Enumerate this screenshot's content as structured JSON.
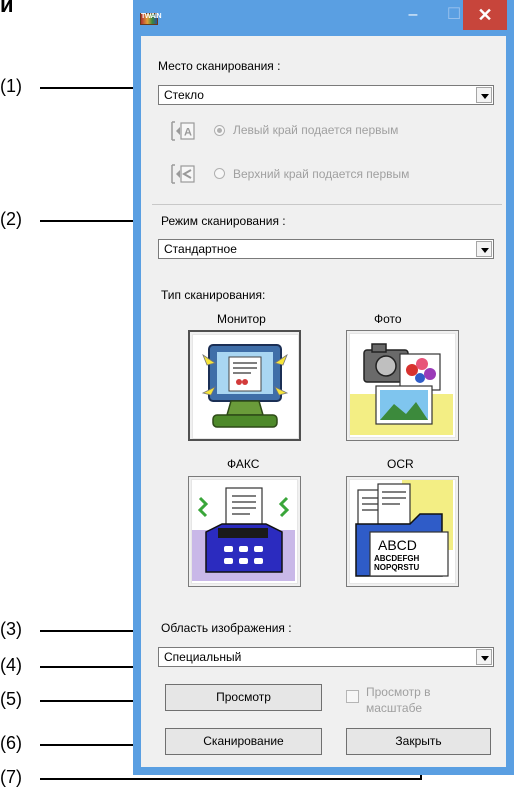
{
  "doc": {
    "corner_title": "и",
    "callouts": [
      "(1)",
      "(2)",
      "(3)",
      "(4)",
      "(5)",
      "(6)",
      "(7)"
    ]
  },
  "window": {
    "app_icon_text": "TWAIN",
    "minimize_glyph": "–",
    "maximize_glyph": "☐",
    "close_glyph": "✕"
  },
  "scan_location": {
    "label": "Место сканирования :",
    "value": "Стекло",
    "feed_icon_1_glyph": "A",
    "feed_option_left": "Левый край подается первым",
    "feed_option_top": "Верхний край подается первым"
  },
  "scan_mode": {
    "label": "Режим сканирования :",
    "value": "Стандартное"
  },
  "scan_type": {
    "label": "Тип сканирования:",
    "types": [
      {
        "label": "Монитор"
      },
      {
        "label": "Фото"
      },
      {
        "label": "ФАКС"
      },
      {
        "label": "OCR",
        "icon_text_1": "ABCD",
        "icon_text_2": "ABCDEFGH",
        "icon_text_3": "NOPQRSTU"
      }
    ]
  },
  "image_area": {
    "label": "Область изображения :",
    "value": "Специальный"
  },
  "buttons": {
    "preview": "Просмотр",
    "zoom_preview": "Просмотр в масштабе",
    "scan": "Сканирование",
    "close": "Закрыть"
  },
  "colors": {
    "window_frame": "#5a9fe2",
    "close_button": "#c7453b",
    "dialog_face": "#f0f0f0"
  }
}
